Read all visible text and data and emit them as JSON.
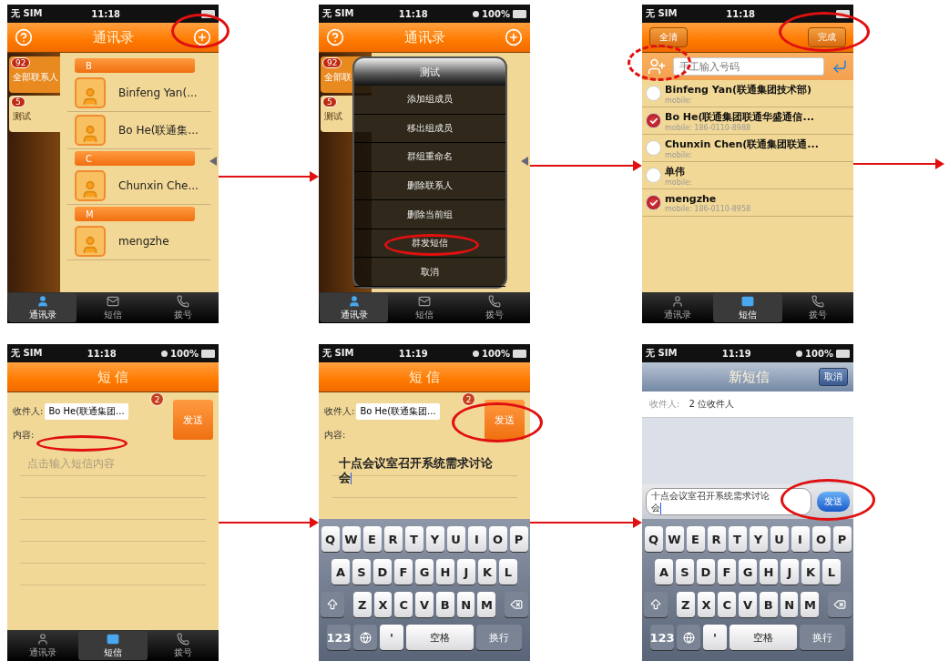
{
  "screens": [
    {
      "kind": "contacts",
      "status": {
        "carrier": "无 SIM",
        "time": "11:18"
      },
      "header": {
        "title": "通讯录"
      },
      "groups": [
        {
          "count": "92",
          "label": "全部联系人",
          "selected": false
        },
        {
          "count": "5",
          "label": "测试",
          "selected": true
        }
      ],
      "sections": [
        {
          "letter": "B",
          "contacts": [
            "Binfeng Yan(...",
            "Bo He(联通集..."
          ]
        },
        {
          "letter": "C",
          "contacts": [
            "Chunxin Che..."
          ]
        },
        {
          "letter": "M",
          "contacts": [
            "mengzhe"
          ]
        }
      ],
      "tabs": [
        {
          "label": "通讯录",
          "selected": true
        },
        {
          "label": "短信",
          "selected": false
        },
        {
          "label": "拨号",
          "selected": false
        }
      ]
    },
    {
      "kind": "contacts",
      "status": {
        "carrier": "无 SIM",
        "time": "11:18",
        "battery": "100%"
      },
      "header": {
        "title": "通讯录"
      },
      "groups": [
        {
          "count": "92",
          "label": "全部联",
          "selected": false
        },
        {
          "count": "5",
          "label": "测试",
          "selected": true
        }
      ],
      "menu": {
        "title": "测试",
        "items": [
          "添加组成员",
          "移出组成员",
          "群组重命名",
          "删除联系人",
          "删除当前组",
          "群发短信",
          "取消"
        ]
      },
      "tabs": [
        {
          "label": "通讯录",
          "selected": true
        },
        {
          "label": "短信",
          "selected": false
        },
        {
          "label": "拨号",
          "selected": false
        }
      ]
    },
    {
      "kind": "picker",
      "status": {
        "carrier": "无 SIM",
        "time": "11:18"
      },
      "buttons": [
        "全清",
        "完成"
      ],
      "search": {
        "placeholder": "手工输入号码"
      },
      "rows": [
        {
          "name": "Binfeng Yan(联通集团技术部)",
          "mobile": "mobile:",
          "checked": false
        },
        {
          "name": "Bo He(联通集团联通华盛通信...",
          "mobile": "mobile: 186-0110-8988",
          "checked": true
        },
        {
          "name": "Chunxin Chen(联通集团联通...",
          "mobile": "mobile:",
          "checked": false
        },
        {
          "name": "单伟",
          "mobile": "mobile:",
          "checked": false
        },
        {
          "name": "mengzhe",
          "mobile": "mobile: 186-0110-8958",
          "checked": true
        }
      ],
      "tabs": [
        {
          "label": "通讯录",
          "selected": false
        },
        {
          "label": "短信",
          "selected": true
        },
        {
          "label": "拨号",
          "selected": false
        }
      ]
    },
    {
      "kind": "compose",
      "status": {
        "carrier": "无 SIM",
        "time": "11:18",
        "battery": "100%"
      },
      "header": {
        "title": "短 信"
      },
      "recipient_label": "收件人:",
      "recipient": "Bo He(联通集团...",
      "badge": "2",
      "send": "发送",
      "content_label": "内容:",
      "content": {
        "placeholder": "点击输入短信内容"
      },
      "tabs": [
        {
          "label": "通讯录",
          "selected": false
        },
        {
          "label": "短信",
          "selected": true
        },
        {
          "label": "拨号",
          "selected": false
        }
      ]
    },
    {
      "kind": "compose",
      "status": {
        "carrier": "无 SIM",
        "time": "11:19",
        "battery": "100%"
      },
      "header": {
        "title": "短 信"
      },
      "recipient_label": "收件人:",
      "recipient": "Bo He(联通集团...",
      "badge": "2",
      "send": "发送",
      "content_label": "内容:",
      "content": {
        "value": "十点会议室召开系统需求讨论会"
      },
      "keyboard": {
        "rows": [
          [
            "Q",
            "W",
            "E",
            "R",
            "T",
            "Y",
            "U",
            "I",
            "O",
            "P"
          ],
          [
            "A",
            "S",
            "D",
            "F",
            "G",
            "H",
            "J",
            "K",
            "L"
          ],
          [
            "Z",
            "X",
            "C",
            "V",
            "B",
            "N",
            "M"
          ]
        ],
        "numbers": "123",
        "apostrophe": "'",
        "space": "空格",
        "return": "换行"
      }
    },
    {
      "kind": "native",
      "status": {
        "carrier": "无 SIM",
        "time": "11:19",
        "battery": "100%"
      },
      "header": {
        "title": "新短信",
        "cancel": "取消"
      },
      "recipient_label": "收件人:",
      "recipient": "2 位收件人",
      "message": "十点会议室召开系统需求讨论会",
      "send": "发送",
      "keyboard": {
        "rows": [
          [
            "Q",
            "W",
            "E",
            "R",
            "T",
            "Y",
            "U",
            "I",
            "O",
            "P"
          ],
          [
            "A",
            "S",
            "D",
            "F",
            "G",
            "H",
            "J",
            "K",
            "L"
          ],
          [
            "Z",
            "X",
            "C",
            "V",
            "B",
            "N",
            "M"
          ]
        ],
        "numbers": "123",
        "apostrophe": "'",
        "space": "空格",
        "return": "换行"
      }
    }
  ]
}
